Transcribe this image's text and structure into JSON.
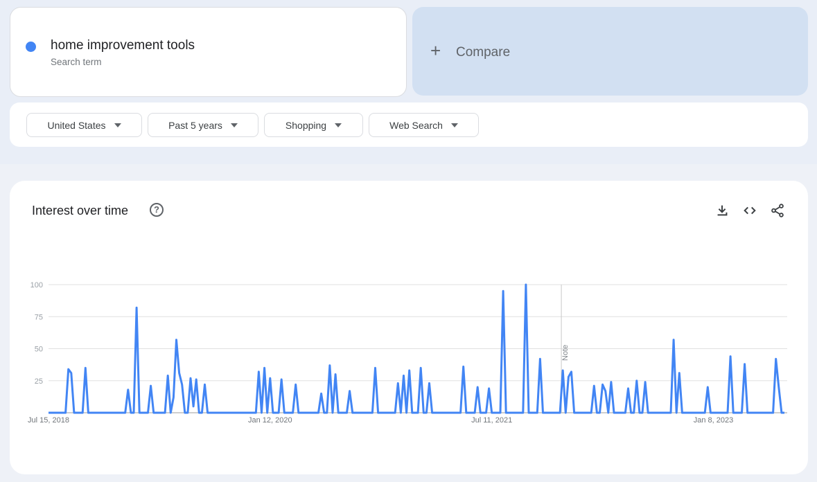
{
  "search_term": {
    "title": "home improvement tools",
    "subtitle": "Search term",
    "color": "#4285f4"
  },
  "compare": {
    "label": "Compare",
    "icon": "plus-icon"
  },
  "filters": [
    {
      "label": "United States",
      "icon": "caret-down-icon"
    },
    {
      "label": "Past 5 years",
      "icon": "caret-down-icon"
    },
    {
      "label": "Shopping",
      "icon": "caret-down-icon"
    },
    {
      "label": "Web Search",
      "icon": "caret-down-icon"
    }
  ],
  "interest_panel": {
    "title": "Interest over time",
    "help_icon": "help-circle-icon",
    "actions": [
      "download-icon",
      "embed-code-icon",
      "share-icon"
    ]
  },
  "chart_data": {
    "type": "line",
    "title": "Interest over time",
    "xlabel": "",
    "ylabel": "",
    "ylim": [
      0,
      100
    ],
    "yticks": [
      100,
      75,
      50,
      25
    ],
    "grid": true,
    "series_color": "#4285f4",
    "x_tick_labels": [
      {
        "label": "Jul 15, 2018",
        "index": 0
      },
      {
        "label": "Jan 12, 2020",
        "index": 78
      },
      {
        "label": "Jul 11, 2021",
        "index": 156
      },
      {
        "label": "Jan 8, 2023",
        "index": 234
      }
    ],
    "annotations": [
      {
        "label": "Note",
        "index": 180
      }
    ],
    "num_points": 260,
    "series": [
      {
        "name": "home improvement tools",
        "points": [
          [
            7,
            34
          ],
          [
            8,
            31
          ],
          [
            13,
            35
          ],
          [
            28,
            18
          ],
          [
            31,
            82
          ],
          [
            36,
            21
          ],
          [
            42,
            29
          ],
          [
            43,
            0
          ],
          [
            44,
            12
          ],
          [
            45,
            57
          ],
          [
            46,
            31
          ],
          [
            47,
            22
          ],
          [
            48,
            0
          ],
          [
            50,
            27
          ],
          [
            51,
            5
          ],
          [
            52,
            26
          ],
          [
            53,
            0
          ],
          [
            55,
            22
          ],
          [
            74,
            32
          ],
          [
            75,
            0
          ],
          [
            76,
            35
          ],
          [
            77,
            0
          ],
          [
            78,
            27
          ],
          [
            82,
            26
          ],
          [
            87,
            22
          ],
          [
            96,
            15
          ],
          [
            99,
            37
          ],
          [
            100,
            0
          ],
          [
            101,
            30
          ],
          [
            106,
            17
          ],
          [
            115,
            35
          ],
          [
            123,
            23
          ],
          [
            124,
            0
          ],
          [
            125,
            29
          ],
          [
            126,
            0
          ],
          [
            127,
            33
          ],
          [
            131,
            35
          ],
          [
            134,
            23
          ],
          [
            146,
            36
          ],
          [
            151,
            20
          ],
          [
            155,
            19
          ],
          [
            160,
            95
          ],
          [
            168,
            100
          ],
          [
            173,
            42
          ],
          [
            181,
            33
          ],
          [
            182,
            0
          ],
          [
            183,
            28
          ],
          [
            184,
            32
          ],
          [
            192,
            21
          ],
          [
            194,
            0
          ],
          [
            195,
            22
          ],
          [
            196,
            17
          ],
          [
            197,
            0
          ],
          [
            198,
            24
          ],
          [
            204,
            19
          ],
          [
            207,
            25
          ],
          [
            210,
            24
          ],
          [
            220,
            57
          ],
          [
            221,
            0
          ],
          [
            222,
            31
          ],
          [
            232,
            20
          ],
          [
            240,
            44
          ],
          [
            245,
            38
          ],
          [
            256,
            42
          ],
          [
            257,
            20
          ],
          [
            258,
            0
          ]
        ]
      }
    ]
  }
}
